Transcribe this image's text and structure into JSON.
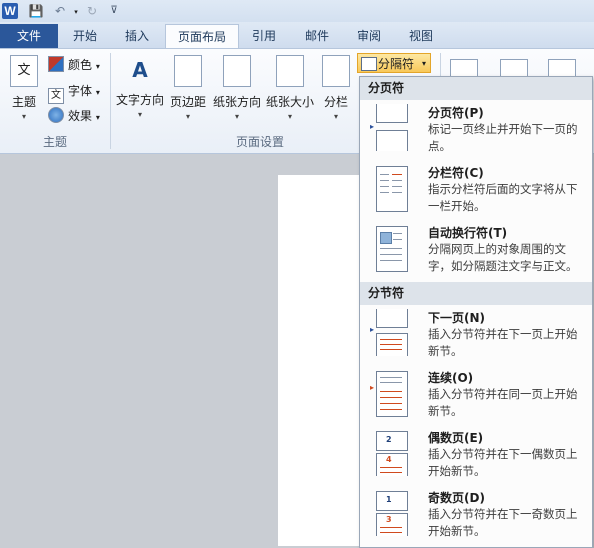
{
  "qat": {
    "word_logo": "W",
    "save": "💾",
    "undo": "↶",
    "redo": "↻",
    "customize": "⊽",
    "caret": "▾"
  },
  "tabs": [
    "文件",
    "开始",
    "插入",
    "页面布局",
    "引用",
    "邮件",
    "审阅",
    "视图"
  ],
  "ribbon": {
    "theme": {
      "label": "主题",
      "icon": "文"
    },
    "colors": "颜色",
    "fonts": "字体",
    "effects": "效果",
    "group_theme": "主题",
    "text_direction": "文字方向",
    "margins": "页边距",
    "orientation": "纸张方向",
    "size": "纸张大小",
    "columns": "分栏",
    "group_page_setup": "页面设置",
    "breaks": "分隔符",
    "dropdown_caret": "▾",
    "textdir_glyph": "A"
  },
  "menu": {
    "page_breaks_header": "分页符",
    "section_breaks_header": "分节符",
    "items": [
      {
        "title": "分页符(P)",
        "desc": "标记一页终止并开始下一页的点。"
      },
      {
        "title": "分栏符(C)",
        "desc": "指示分栏符后面的文字将从下一栏开始。"
      },
      {
        "title": "自动换行符(T)",
        "desc": "分隔网页上的对象周围的文字，如分隔题注文字与正文。"
      },
      {
        "title": "下一页(N)",
        "desc": "插入分节符并在下一页上开始新节。"
      },
      {
        "title": "连续(O)",
        "desc": "插入分节符并在同一页上开始新节。"
      },
      {
        "title": "偶数页(E)",
        "desc": "插入分节符并在下一偶数页上开始新节。"
      },
      {
        "title": "奇数页(D)",
        "desc": "插入分节符并在下一奇数页上开始新节。"
      }
    ],
    "even_num_a": "2",
    "even_num_b": "4",
    "odd_num_a": "1",
    "odd_num_b": "3"
  }
}
